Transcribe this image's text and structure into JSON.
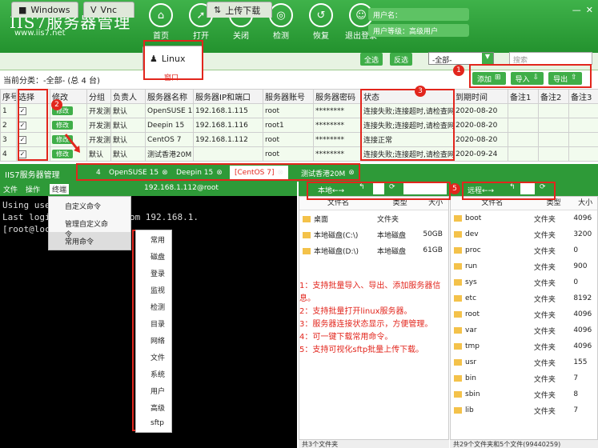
{
  "header": {
    "logo": "IIS7服务器管理",
    "url": "www.iis7.net",
    "nav": [
      {
        "label": "首页",
        "icon": "home-icon",
        "glyph": "⌂"
      },
      {
        "label": "打开",
        "icon": "rocket-icon",
        "glyph": "➚"
      },
      {
        "label": "关闭",
        "icon": "close-rocket-icon",
        "glyph": "✕"
      },
      {
        "label": "检测",
        "icon": "detect-icon",
        "glyph": "◎"
      },
      {
        "label": "恢复",
        "icon": "restore-icon",
        "glyph": "↺"
      },
      {
        "label": "退出登录",
        "icon": "logout-icon",
        "glyph": "☺"
      }
    ],
    "username_label": "用户名：",
    "userlevel": "用户等级：高级用户"
  },
  "tabs": [
    {
      "label": "Windows",
      "glyph": "■"
    },
    {
      "label": "Vnc",
      "glyph": "V"
    },
    {
      "label": "Linux",
      "glyph": "♟",
      "sub": "窗口"
    },
    {
      "label": "上传下载",
      "glyph": "⇅"
    }
  ],
  "toolbar": {
    "select_all": "全选",
    "invert": "反选",
    "filter": "-全部-",
    "search_placeholder": "搜索"
  },
  "crumb": "当前分类：-全部- (总 4 台)",
  "actions": {
    "add": "添加",
    "import": "导入",
    "export": "导出"
  },
  "columns": [
    "序号",
    "选择",
    "修改",
    "分组",
    "负责人",
    "服务器名称",
    "服务器IP和端口",
    "服务器账号",
    "服务器密码",
    "状态",
    "到期时间",
    "备注1",
    "备注2",
    "备注3"
  ],
  "rows": [
    {
      "no": "1",
      "edit": "修改",
      "group": "开发测",
      "owner": "默认",
      "name": "OpenSUSE 1",
      "ip": "192.168.1.115",
      "acct": "root",
      "pwd": "********",
      "status": "连接失败;连接超时,请检查网",
      "expire": "2020-08-20"
    },
    {
      "no": "2",
      "edit": "修改",
      "group": "开发测",
      "owner": "默认",
      "name": "Deepin 15",
      "ip": "192.168.1.116",
      "acct": "root1",
      "pwd": "********",
      "status": "连接失败;连接超时,请检查网",
      "expire": "2020-08-20"
    },
    {
      "no": "3",
      "edit": "修改",
      "group": "开发测",
      "owner": "默认",
      "name": "CentOS 7",
      "ip": "192.168.1.112",
      "acct": "root",
      "pwd": "********",
      "status": "连接正常",
      "expire": "2020-08-20"
    },
    {
      "no": "4",
      "edit": "修改",
      "group": "默认",
      "owner": "默认",
      "name": "测试香港20M",
      "ip": "",
      "acct": "root",
      "pwd": "********",
      "status": "连接失败;连接超时,请检查网",
      "expire": "2020-09-24"
    }
  ],
  "session": {
    "title": "IIS7服务器管理",
    "count": "4",
    "tabs": [
      "OpenSUSE 15",
      "Deepin 15",
      "[CentOS 7]",
      "测试香港20M"
    ]
  },
  "term": {
    "menu": [
      "文件",
      "操作",
      "终端"
    ],
    "host": "192.168.1.112@root",
    "lines": [
      "Using use",
      "Last logi        :37:01 2020 from 192.168.1.",
      "[root@loc"
    ]
  },
  "menu1": [
    "自定义命令",
    "管理自定义命令",
    "常用命令"
  ],
  "menu2": [
    "常用",
    "磁盘",
    "登录",
    "监视",
    "检测",
    "目录",
    "网络",
    "文件",
    "系统",
    "用户",
    "高级",
    "sftp"
  ],
  "local": {
    "label": "本地←→",
    "cols": [
      "文件名",
      "类型",
      "大小"
    ],
    "rows": [
      [
        "桌面",
        "文件夹",
        ""
      ],
      [
        "本地磁盘(C:\\)",
        "本地磁盘",
        "50GB"
      ],
      [
        "本地磁盘(D:\\)",
        "本地磁盘",
        "61GB"
      ]
    ],
    "status": "共3个文件夹"
  },
  "remote": {
    "label": "远程←→",
    "cols": [
      "文件名",
      "类型",
      "大小"
    ],
    "rows": [
      [
        "boot",
        "文件夹",
        "4096"
      ],
      [
        "dev",
        "文件夹",
        "3200"
      ],
      [
        "proc",
        "文件夹",
        "0"
      ],
      [
        "run",
        "文件夹",
        "900"
      ],
      [
        "sys",
        "文件夹",
        "0"
      ],
      [
        "etc",
        "文件夹",
        "8192"
      ],
      [
        "root",
        "文件夹",
        "4096"
      ],
      [
        "var",
        "文件夹",
        "4096"
      ],
      [
        "tmp",
        "文件夹",
        "4096"
      ],
      [
        "usr",
        "文件夹",
        "155"
      ],
      [
        "bin",
        "文件夹",
        "7"
      ],
      [
        "sbin",
        "文件夹",
        "8"
      ],
      [
        "lib",
        "文件夹",
        "7"
      ]
    ],
    "status": "共29个文件夹和5个文件(99440259)"
  },
  "notes": [
    "1：支持批量导入、导出、添加服务器信息。",
    "2：支持批量打开linux服务器。",
    "3：服务器连接状态显示，方便管理。",
    "4：可一键下载常用命令。",
    "5：支持可视化sftp批量上传下载。"
  ],
  "markers": [
    "1",
    "2",
    "3",
    "4",
    "5"
  ]
}
